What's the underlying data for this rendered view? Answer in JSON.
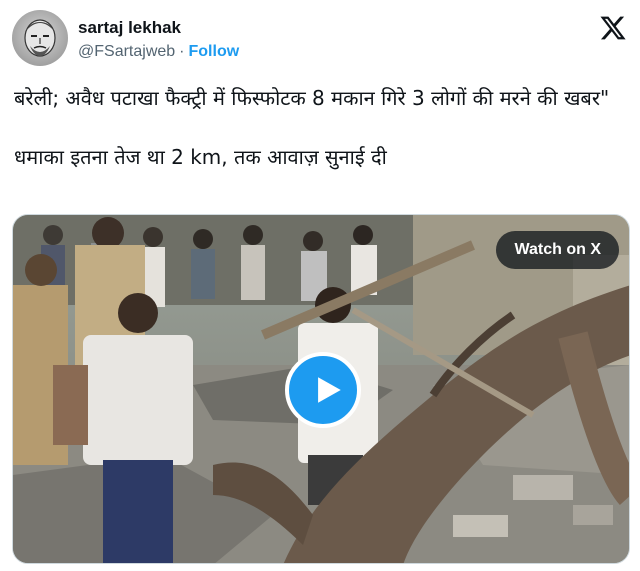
{
  "author": {
    "name": "sartaj lekhak",
    "handle": "@FSartajweb",
    "separator": "·",
    "follow_label": "Follow",
    "avatar_icon": "avatar-sketch-portrait"
  },
  "brand": {
    "logo_icon": "x-logo-icon",
    "color": "#0f1419"
  },
  "tweet": {
    "paragraph1": "बरेली; अवैध पटाखा फैक्ट्री में फिस्फोटक 8 मकान गिरे 3 लोगों की मरने की खबर\"",
    "paragraph2": "धमाका इतना तेज था 2 km, तक आवाज़ सुनाई दी"
  },
  "media": {
    "watch_label": "Watch on X",
    "play_icon": "play-icon",
    "accent": "#1d9bf0"
  }
}
